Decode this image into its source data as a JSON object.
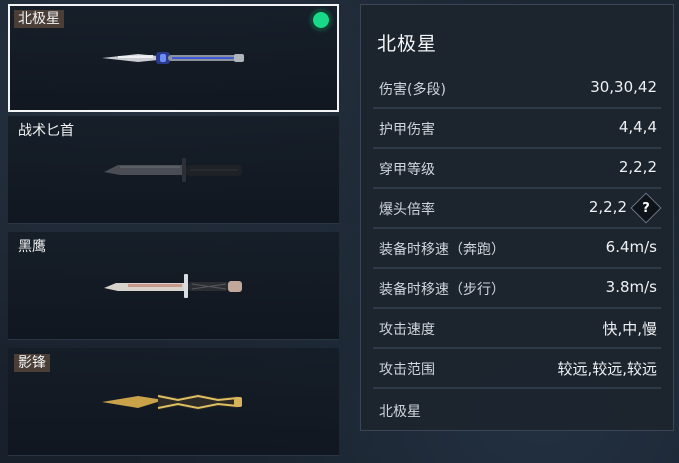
{
  "weapons": [
    {
      "name": "北极星",
      "tagged": true,
      "selected": true,
      "owned": true
    },
    {
      "name": "战术匕首",
      "tagged": false,
      "selected": false,
      "owned": false
    },
    {
      "name": "黑鹰",
      "tagged": false,
      "selected": false,
      "owned": false
    },
    {
      "name": "影锋",
      "tagged": true,
      "selected": false,
      "owned": false
    }
  ],
  "detail": {
    "title": "北极星",
    "stats": [
      {
        "label": "伤害(多段)",
        "value": "30,30,42"
      },
      {
        "label": "护甲伤害",
        "value": "4,4,4"
      },
      {
        "label": "穿甲等级",
        "value": "2,2,2"
      },
      {
        "label": "爆头倍率",
        "value": "2,2,2",
        "help": "?"
      },
      {
        "label": "装备时移速（奔跑）",
        "value": "6.4m/s"
      },
      {
        "label": "装备时移速（步行）",
        "value": "3.8m/s"
      },
      {
        "label": "攻击速度",
        "value": "快,中,慢"
      },
      {
        "label": "攻击范围",
        "value": "较远,较远,较远"
      }
    ],
    "footer": "北极星"
  },
  "colors": {
    "owned_indicator": "#18d98a",
    "selected_border": "#f2f4f6",
    "tag_bg": "#4a3e36"
  }
}
